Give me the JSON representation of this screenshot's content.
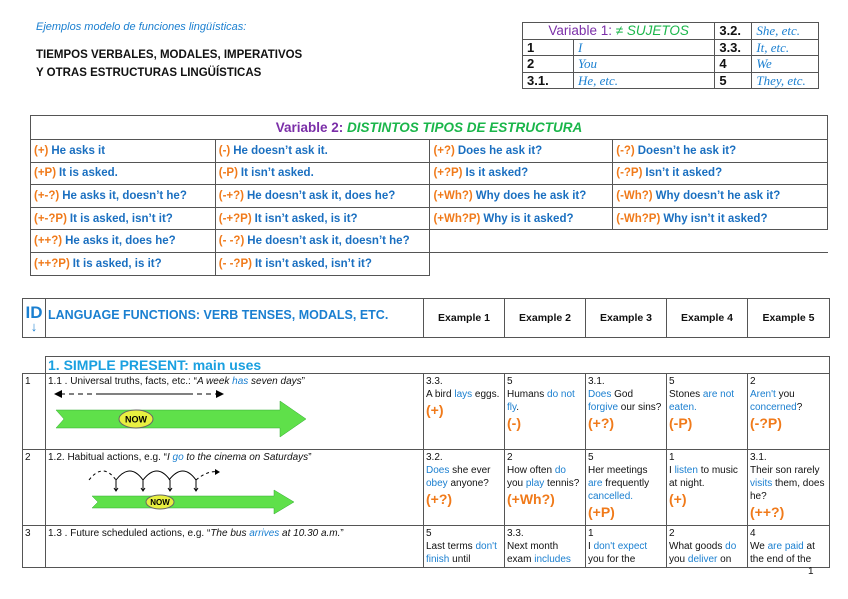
{
  "header": {
    "subtitle": "Ejemplos modelo de funciones lingüísticas:",
    "title_line1": "TIEMPOS VERBALES, MODALES, IMPERATIVOS",
    "title_line2": "Y OTRAS ESTRUCTURAS LINGÜÍSTICAS"
  },
  "variable1": {
    "label": "Variable 1:",
    "label_highlight": "≠ SUJETOS",
    "cells": [
      [
        "1",
        "I"
      ],
      [
        "2",
        "You"
      ],
      [
        "3.1.",
        "He, etc."
      ],
      [
        "3.2.",
        "She, etc."
      ],
      [
        "3.3.",
        "It, etc."
      ],
      [
        "4",
        "We"
      ],
      [
        "5",
        "They, etc."
      ]
    ]
  },
  "variable2": {
    "label": "Variable 2:",
    "label_highlight": "DISTINTOS TIPOS DE ESTRUCTURA",
    "rows": [
      [
        [
          "(+)",
          "He asks it"
        ],
        [
          "(-)",
          "He doesn’t ask it."
        ],
        [
          "(+?)",
          "Does he ask it?"
        ],
        [
          "(-?)",
          "Doesn’t he ask it?"
        ]
      ],
      [
        [
          "(+P)",
          "It is asked."
        ],
        [
          "(-P)",
          "It isn’t asked."
        ],
        [
          "(+?P)",
          "Is it asked?"
        ],
        [
          "(-?P)",
          "Isn’t it asked?"
        ]
      ],
      [
        [
          "(+-?)",
          "He asks it, doesn’t he?"
        ],
        [
          "(-+?)",
          "He doesn’t ask it, does he?"
        ],
        [
          "(+Wh?)",
          "Why does he ask it?"
        ],
        [
          "(-Wh?)",
          "Why doesn’t he ask it?"
        ]
      ],
      [
        [
          "(+-?P)",
          "It is asked, isn’t it?"
        ],
        [
          "(-+?P)",
          "It isn’t asked, is it?"
        ],
        [
          "(+Wh?P)",
          "Why is it asked?"
        ],
        [
          "(-Wh?P)",
          "Why isn’t it asked?"
        ]
      ],
      [
        [
          "(++?)",
          "He asks it, does he?"
        ],
        [
          "(- -?)",
          "He doesn’t ask it, doesn’t he?"
        ]
      ],
      [
        [
          "(++?P)",
          "It is asked, is it?"
        ],
        [
          "(- -?P)",
          "It isn’t asked, isn’t it?"
        ]
      ]
    ]
  },
  "main": {
    "id_label": "ID",
    "id_arrow": "↓",
    "title": "LANGUAGE FUNCTIONS: VERB TENSES, MODALS, ETC.",
    "example_headers": [
      "Example 1",
      "Example 2",
      "Example 3",
      "Example 4",
      "Example 5"
    ],
    "section": "1. SIMPLE PRESENT: main uses",
    "now_label": "NOW",
    "rows": [
      {
        "id": "1",
        "desc": [
          [
            "1.1 . Universal truths, facts, etc.: “",
            ""
          ],
          [
            "A week ",
            "i"
          ],
          [
            "has",
            "ib"
          ],
          [
            " seven days",
            "i"
          ],
          [
            "”",
            ""
          ]
        ],
        "examples": [
          {
            "ref": "3.3.",
            "text": [
              [
                "A bird ",
                ""
              ],
              [
                "lays",
                "b"
              ],
              [
                " eggs.",
                ""
              ]
            ],
            "tag": "(+)"
          },
          {
            "ref": "5",
            "text": [
              [
                "Humans ",
                ""
              ],
              [
                "do not fly",
                "b"
              ],
              [
                ".",
                ""
              ]
            ],
            "tag": "(-)"
          },
          {
            "ref": "3.1.",
            "text": [
              [
                "Does",
                "b"
              ],
              [
                " God ",
                ""
              ],
              [
                "forgive",
                "b"
              ],
              [
                " our sins? ",
                ""
              ]
            ],
            "tag": "(+?)",
            "inline": true
          },
          {
            "ref": "5",
            "text": [
              [
                "Stones ",
                ""
              ],
              [
                "are not eaten.",
                "b"
              ]
            ],
            "tag": "(-P)"
          },
          {
            "ref": "2",
            "text": [
              [
                "Aren't",
                "b"
              ],
              [
                " you ",
                ""
              ],
              [
                "concerned",
                "b"
              ],
              [
                "?",
                ""
              ]
            ],
            "tag": "(-?P)"
          }
        ]
      },
      {
        "id": "2",
        "desc": [
          [
            "1.2. Habitual actions, e.g. “",
            ""
          ],
          [
            "I ",
            "i"
          ],
          [
            "go",
            "ib"
          ],
          [
            " to the cinema on Saturdays",
            "i"
          ],
          [
            "”",
            ""
          ]
        ],
        "examples": [
          {
            "ref": "3.2.",
            "text": [
              [
                "Does",
                "b"
              ],
              [
                " she ever ",
                ""
              ],
              [
                "obey",
                "b"
              ],
              [
                " anyone?",
                ""
              ]
            ],
            "tag": "(+?)"
          },
          {
            "ref": "2",
            "text": [
              [
                "How often ",
                ""
              ],
              [
                "do",
                "b"
              ],
              [
                " you ",
                ""
              ],
              [
                "play",
                "b"
              ],
              [
                " tennis?",
                ""
              ]
            ],
            "tag": "(+Wh?)"
          },
          {
            "ref": "5",
            "text": [
              [
                "Her meetings ",
                ""
              ],
              [
                "are",
                "b"
              ],
              [
                " frequently ",
                ""
              ],
              [
                "cancelled.",
                "b"
              ]
            ],
            "tag": "(+P)"
          },
          {
            "ref": "1",
            "text": [
              [
                "I ",
                ""
              ],
              [
                "listen",
                "b"
              ],
              [
                " to music at night.",
                ""
              ]
            ],
            "tag": "(+)"
          },
          {
            "ref": "3.1.",
            "text": [
              [
                "Their son rarely ",
                ""
              ],
              [
                "visits",
                "b"
              ],
              [
                " them, does he?",
                ""
              ]
            ],
            "tag": "(++?)"
          }
        ]
      },
      {
        "id": "3",
        "desc": [
          [
            "1.3 . Future scheduled actions, e.g. “",
            ""
          ],
          [
            "The bus ",
            "i"
          ],
          [
            "arrives",
            "ib"
          ],
          [
            " at 10.30 a.m.",
            "i"
          ],
          [
            "”",
            ""
          ]
        ],
        "examples": [
          {
            "ref": "5",
            "text": [
              [
                "Last terms ",
                ""
              ],
              [
                "don't finish",
                "b"
              ],
              [
                " until",
                ""
              ]
            ],
            "tag": ""
          },
          {
            "ref": "3.3.",
            "text": [
              [
                "Next month exam ",
                ""
              ],
              [
                "includes",
                "b"
              ]
            ],
            "tag": ""
          },
          {
            "ref": "1",
            "text": [
              [
                "I ",
                ""
              ],
              [
                "don't expect",
                "b"
              ],
              [
                " you for the",
                ""
              ]
            ],
            "tag": ""
          },
          {
            "ref": "2",
            "text": [
              [
                "What goods ",
                ""
              ],
              [
                "do",
                "b"
              ],
              [
                " you ",
                ""
              ],
              [
                "deliver",
                "b"
              ],
              [
                " on",
                ""
              ]
            ],
            "tag": ""
          },
          {
            "ref": "4",
            "text": [
              [
                "We ",
                ""
              ],
              [
                "are paid",
                "b"
              ],
              [
                " at the end of the",
                ""
              ]
            ],
            "tag": ""
          }
        ]
      }
    ]
  },
  "page_number": "1",
  "colors": {
    "blue": "#1a7fd0",
    "orange": "#f07a1a",
    "purple": "#7b2fa8",
    "green": "#1ab64a",
    "arrow_green": "#5fe04a"
  }
}
